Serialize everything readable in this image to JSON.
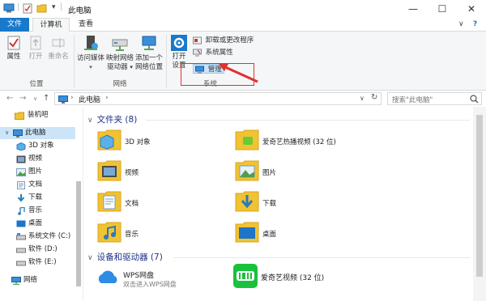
{
  "window": {
    "title": "此电脑",
    "minimize": "—",
    "maximize": "☐",
    "close": "✕",
    "qat_dropdown": "▾"
  },
  "ribbon_tabs": {
    "file": "文件",
    "computer": "计算机",
    "view": "查看",
    "collapse": "∨",
    "help": "?"
  },
  "ribbon": {
    "location": {
      "label": "位置",
      "properties": "属性",
      "open": "打开",
      "rename": "重命名"
    },
    "network": {
      "label": "网络",
      "access_media": "访问媒体",
      "map_drive_1": "映射网络",
      "map_drive_2": "驱动器",
      "add_location_1": "添加一个",
      "add_location_2": "网络位置"
    },
    "system": {
      "label": "系统",
      "open_settings_1": "打开",
      "open_settings_2": "设置",
      "uninstall": "卸载或更改程序",
      "system_properties": "系统属性",
      "manage": "管理"
    },
    "colors": {
      "highlight": "#e03030",
      "file_tab": "#1979ca"
    }
  },
  "address": {
    "path_root": "›",
    "path": "此电脑",
    "path_sep": "›",
    "dropdown": "∨",
    "refresh": "↻",
    "search_placeholder": "搜索\"此电脑\"",
    "search_icon": "search-icon"
  },
  "nav": {
    "items": [
      {
        "label": "装机吧",
        "icon": "folder-icon"
      },
      {
        "label": "此电脑",
        "icon": "computer-icon"
      },
      {
        "label": "3D 对象",
        "icon": "cube-icon"
      },
      {
        "label": "视频",
        "icon": "video-icon"
      },
      {
        "label": "图片",
        "icon": "picture-icon"
      },
      {
        "label": "文档",
        "icon": "document-icon"
      },
      {
        "label": "下载",
        "icon": "download-icon"
      },
      {
        "label": "音乐",
        "icon": "music-icon"
      },
      {
        "label": "桌面",
        "icon": "desktop-icon"
      },
      {
        "label": "系统文件 (C:)",
        "icon": "drive-icon"
      },
      {
        "label": "软件 (D:)",
        "icon": "drive-icon"
      },
      {
        "label": "软件 (E:)",
        "icon": "drive-icon"
      },
      {
        "label": "网络",
        "icon": "network-icon"
      }
    ]
  },
  "content": {
    "folders_header": "文件夹 (8)",
    "folders": [
      "3D 对象",
      "爱奇艺热播视频 (32 位)",
      "视频",
      "图片",
      "文档",
      "下载",
      "音乐",
      "桌面"
    ],
    "drives_header": "设备和驱动器 (7)",
    "drives": [
      {
        "label": "WPS网盘",
        "sub": "双击进入WPS网盘"
      },
      {
        "label": "爱奇艺视频 (32 位)",
        "sub": ""
      }
    ]
  }
}
